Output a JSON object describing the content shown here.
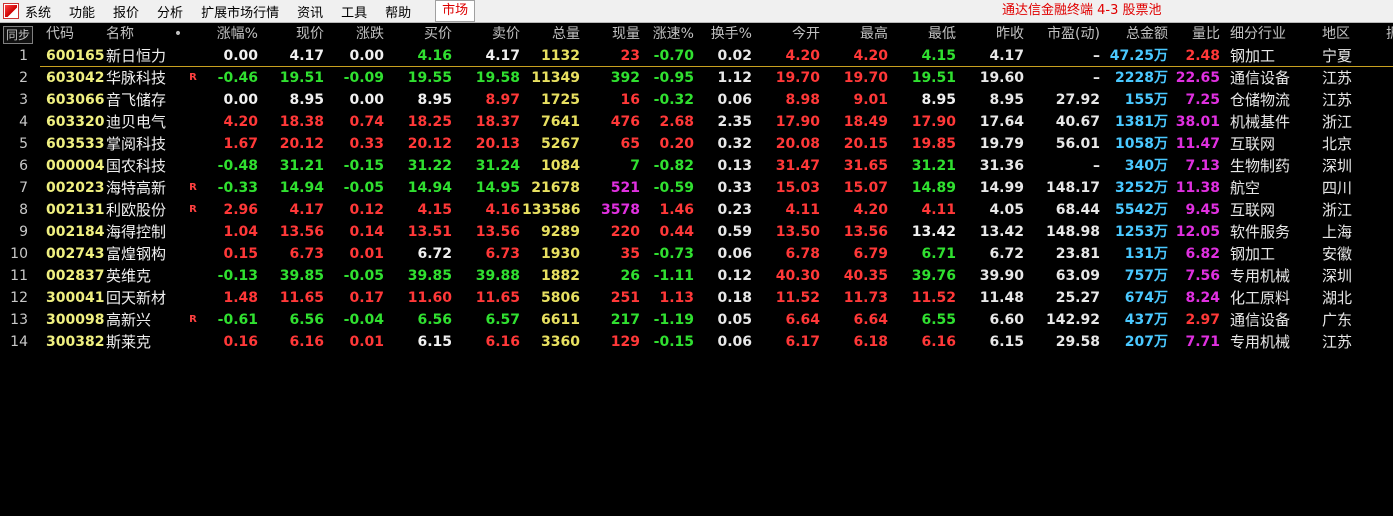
{
  "menu": {
    "items": [
      "系统",
      "功能",
      "报价",
      "分析",
      "扩展市场行情",
      "资讯",
      "工具",
      "帮助"
    ],
    "market_tab": "市场"
  },
  "window_title": "通达信金融终端  4-3 股票池",
  "colors": {
    "up": "#ff3838",
    "down": "#30e030",
    "amount": "#4ac8ff",
    "volume": "#e8e060",
    "ratio": "#e030e0"
  },
  "header": {
    "sync": "同步",
    "code": "代码",
    "name": "名称",
    "dot": "•",
    "change_pct": "涨幅%",
    "price": "现价",
    "change": "涨跌",
    "bid": "买价",
    "ask": "卖价",
    "volume": "总量",
    "cur_vol": "现量",
    "speed": "涨速%",
    "turnover": "换手%",
    "open": "今开",
    "high": "最高",
    "low": "最低",
    "prev_close": "昨收",
    "pe": "市盈(动)",
    "amount": "总金额",
    "vol_ratio": "量比",
    "industry": "细分行业",
    "region": "地区",
    "extra": "振"
  },
  "rows": [
    {
      "idx": "1",
      "code": "600165",
      "name": "新日恒力",
      "flag": "",
      "change_pct": "0.00",
      "price": "4.17",
      "change": "0.00",
      "bid": "4.16",
      "ask": "4.17",
      "volume": "1132",
      "cur_vol": "23",
      "speed": "-0.70",
      "turnover": "0.02",
      "open": "4.20",
      "high": "4.20",
      "low": "4.15",
      "prev_close": "4.17",
      "pe": "–",
      "amount": "47.25万",
      "vol_ratio": "2.48",
      "industry": "钢加工",
      "region": "宁夏"
    },
    {
      "idx": "2",
      "code": "603042",
      "name": "华脉科技",
      "flag": "R",
      "change_pct": "-0.46",
      "price": "19.51",
      "change": "-0.09",
      "bid": "19.55",
      "ask": "19.58",
      "volume": "11349",
      "cur_vol": "392",
      "speed": "-0.95",
      "turnover": "1.12",
      "open": "19.70",
      "high": "19.70",
      "low": "19.51",
      "prev_close": "19.60",
      "pe": "–",
      "amount": "2228万",
      "vol_ratio": "22.65",
      "industry": "通信设备",
      "region": "江苏"
    },
    {
      "idx": "3",
      "code": "603066",
      "name": "音飞储存",
      "flag": "",
      "change_pct": "0.00",
      "price": "8.95",
      "change": "0.00",
      "bid": "8.95",
      "ask": "8.97",
      "volume": "1725",
      "cur_vol": "16",
      "speed": "-0.32",
      "turnover": "0.06",
      "open": "8.98",
      "high": "9.01",
      "low": "8.95",
      "prev_close": "8.95",
      "pe": "27.92",
      "amount": "155万",
      "vol_ratio": "7.25",
      "industry": "仓储物流",
      "region": "江苏"
    },
    {
      "idx": "4",
      "code": "603320",
      "name": "迪贝电气",
      "flag": "",
      "change_pct": "4.20",
      "price": "18.38",
      "change": "0.74",
      "bid": "18.25",
      "ask": "18.37",
      "volume": "7641",
      "cur_vol": "476",
      "speed": "2.68",
      "turnover": "2.35",
      "open": "17.90",
      "high": "18.49",
      "low": "17.90",
      "prev_close": "17.64",
      "pe": "40.67",
      "amount": "1381万",
      "vol_ratio": "38.01",
      "industry": "机械基件",
      "region": "浙江"
    },
    {
      "idx": "5",
      "code": "603533",
      "name": "掌阅科技",
      "flag": "",
      "change_pct": "1.67",
      "price": "20.12",
      "change": "0.33",
      "bid": "20.12",
      "ask": "20.13",
      "volume": "5267",
      "cur_vol": "65",
      "speed": "0.20",
      "turnover": "0.32",
      "open": "20.08",
      "high": "20.15",
      "low": "19.85",
      "prev_close": "19.79",
      "pe": "56.01",
      "amount": "1058万",
      "vol_ratio": "11.47",
      "industry": "互联网",
      "region": "北京"
    },
    {
      "idx": "6",
      "code": "000004",
      "name": "国农科技",
      "flag": "",
      "change_pct": "-0.48",
      "price": "31.21",
      "change": "-0.15",
      "bid": "31.22",
      "ask": "31.24",
      "volume": "1084",
      "cur_vol": "7",
      "speed": "-0.82",
      "turnover": "0.13",
      "open": "31.47",
      "high": "31.65",
      "low": "31.21",
      "prev_close": "31.36",
      "pe": "–",
      "amount": "340万",
      "vol_ratio": "7.13",
      "industry": "生物制药",
      "region": "深圳"
    },
    {
      "idx": "7",
      "code": "002023",
      "name": "海特高新",
      "flag": "R",
      "change_pct": "-0.33",
      "price": "14.94",
      "change": "-0.05",
      "bid": "14.94",
      "ask": "14.95",
      "volume": "21678",
      "cur_vol": "521",
      "speed": "-0.59",
      "turnover": "0.33",
      "open": "15.03",
      "high": "15.07",
      "low": "14.89",
      "prev_close": "14.99",
      "pe": "148.17",
      "amount": "3252万",
      "vol_ratio": "11.38",
      "industry": "航空",
      "region": "四川"
    },
    {
      "idx": "8",
      "code": "002131",
      "name": "利欧股份",
      "flag": "R",
      "change_pct": "2.96",
      "price": "4.17",
      "change": "0.12",
      "bid": "4.15",
      "ask": "4.16",
      "volume": "133586",
      "cur_vol": "3578",
      "speed": "1.46",
      "turnover": "0.23",
      "open": "4.11",
      "high": "4.20",
      "low": "4.11",
      "prev_close": "4.05",
      "pe": "68.44",
      "amount": "5542万",
      "vol_ratio": "9.45",
      "industry": "互联网",
      "region": "浙江"
    },
    {
      "idx": "9",
      "code": "002184",
      "name": "海得控制",
      "flag": "",
      "change_pct": "1.04",
      "price": "13.56",
      "change": "0.14",
      "bid": "13.51",
      "ask": "13.56",
      "volume": "9289",
      "cur_vol": "220",
      "speed": "0.44",
      "turnover": "0.59",
      "open": "13.50",
      "high": "13.56",
      "low": "13.42",
      "prev_close": "13.42",
      "pe": "148.98",
      "amount": "1253万",
      "vol_ratio": "12.05",
      "industry": "软件服务",
      "region": "上海"
    },
    {
      "idx": "10",
      "code": "002743",
      "name": "富煌钢构",
      "flag": "",
      "change_pct": "0.15",
      "price": "6.73",
      "change": "0.01",
      "bid": "6.72",
      "ask": "6.73",
      "volume": "1930",
      "cur_vol": "35",
      "speed": "-0.73",
      "turnover": "0.06",
      "open": "6.78",
      "high": "6.79",
      "low": "6.71",
      "prev_close": "6.72",
      "pe": "23.81",
      "amount": "131万",
      "vol_ratio": "6.82",
      "industry": "钢加工",
      "region": "安徽"
    },
    {
      "idx": "11",
      "code": "002837",
      "name": "英维克",
      "flag": "",
      "change_pct": "-0.13",
      "price": "39.85",
      "change": "-0.05",
      "bid": "39.85",
      "ask": "39.88",
      "volume": "1882",
      "cur_vol": "26",
      "speed": "-1.11",
      "turnover": "0.12",
      "open": "40.30",
      "high": "40.35",
      "low": "39.76",
      "prev_close": "39.90",
      "pe": "63.09",
      "amount": "757万",
      "vol_ratio": "7.56",
      "industry": "专用机械",
      "region": "深圳"
    },
    {
      "idx": "12",
      "code": "300041",
      "name": "回天新材",
      "flag": "",
      "change_pct": "1.48",
      "price": "11.65",
      "change": "0.17",
      "bid": "11.60",
      "ask": "11.65",
      "volume": "5806",
      "cur_vol": "251",
      "speed": "1.13",
      "turnover": "0.18",
      "open": "11.52",
      "high": "11.73",
      "low": "11.52",
      "prev_close": "11.48",
      "pe": "25.27",
      "amount": "674万",
      "vol_ratio": "8.24",
      "industry": "化工原料",
      "region": "湖北"
    },
    {
      "idx": "13",
      "code": "300098",
      "name": "高新兴",
      "flag": "R",
      "change_pct": "-0.61",
      "price": "6.56",
      "change": "-0.04",
      "bid": "6.56",
      "ask": "6.57",
      "volume": "6611",
      "cur_vol": "217",
      "speed": "-1.19",
      "turnover": "0.05",
      "open": "6.64",
      "high": "6.64",
      "low": "6.55",
      "prev_close": "6.60",
      "pe": "142.92",
      "amount": "437万",
      "vol_ratio": "2.97",
      "industry": "通信设备",
      "region": "广东"
    },
    {
      "idx": "14",
      "code": "300382",
      "name": "斯莱克",
      "flag": "",
      "change_pct": "0.16",
      "price": "6.16",
      "change": "0.01",
      "bid": "6.15",
      "ask": "6.16",
      "volume": "3360",
      "cur_vol": "129",
      "speed": "-0.15",
      "turnover": "0.06",
      "open": "6.17",
      "high": "6.18",
      "low": "6.16",
      "prev_close": "6.15",
      "pe": "29.58",
      "amount": "207万",
      "vol_ratio": "7.71",
      "industry": "专用机械",
      "region": "江苏"
    }
  ]
}
